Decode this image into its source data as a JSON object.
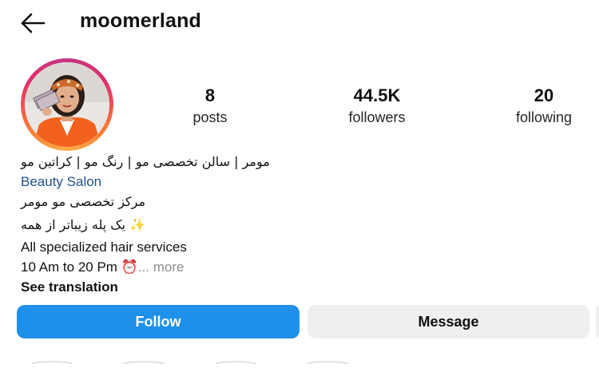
{
  "header": {
    "username": "moomerland"
  },
  "stats": [
    {
      "value": "8",
      "label": "posts"
    },
    {
      "value": "44.5K",
      "label": "followers"
    },
    {
      "value": "20",
      "label": "following"
    }
  ],
  "bio": {
    "name_line": "مومر | سالن تخصصی مو | رنگ مو | کراتین مو",
    "category": "Beauty Salon",
    "line1": "مرکز تخصصی مو مومر",
    "line2": "✨ یک پله زیباتر از همه",
    "line3": "All specialized hair services",
    "line4": "10 Am to 20 Pm ⏰",
    "more": "... more",
    "see_translation": "See translation"
  },
  "actions": {
    "follow": "Follow",
    "message": "Message"
  },
  "colors": {
    "follow_bg": "#1e90ea",
    "message_bg": "#efefef",
    "category_text": "#1f4f8f"
  },
  "icons": {
    "back": "back-arrow-icon",
    "ring": "story-ring"
  }
}
